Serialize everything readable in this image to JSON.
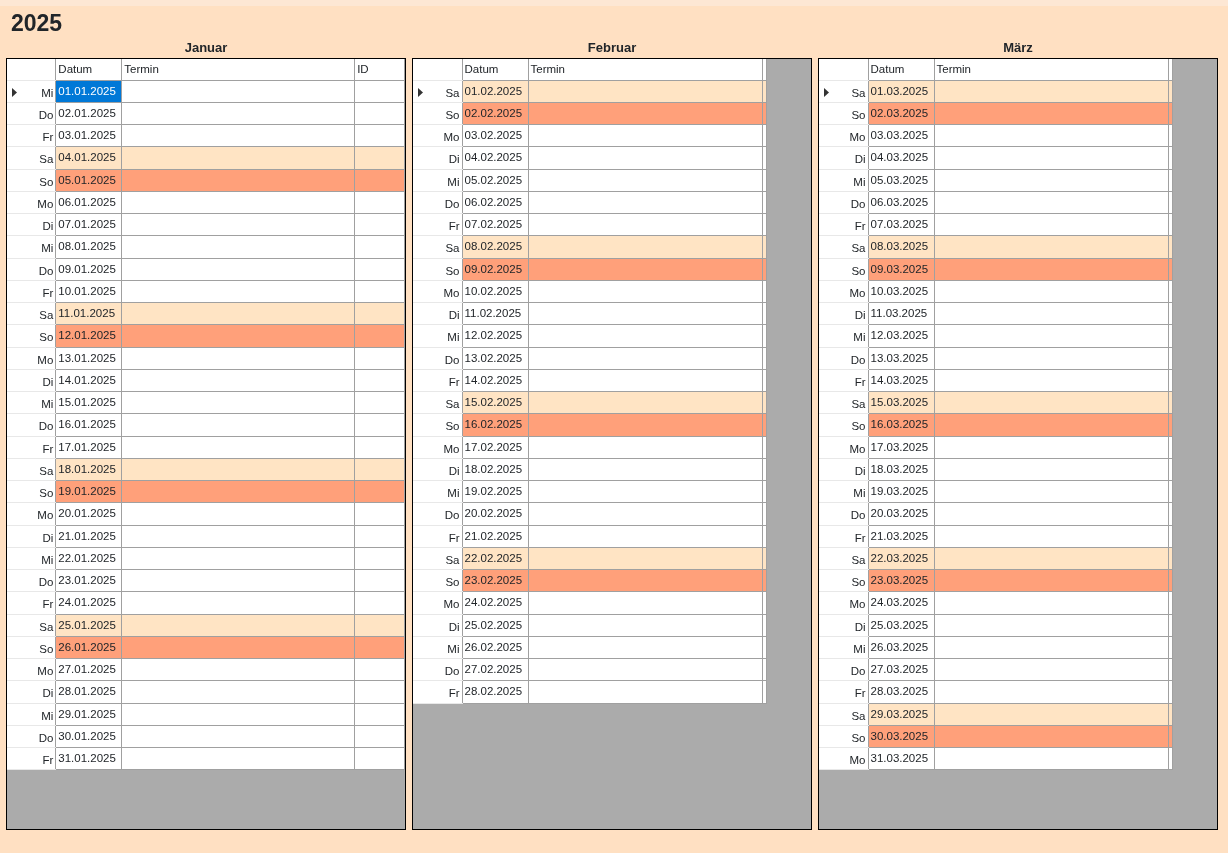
{
  "title": "2025",
  "months": [
    {
      "name": "Januar",
      "columns": [
        "Datum",
        "Termin",
        "ID"
      ],
      "rows": [
        {
          "day": "Mi",
          "date": "01.01.2025",
          "kind": "weekday",
          "current": true,
          "selected": true
        },
        {
          "day": "Do",
          "date": "02.01.2025",
          "kind": "weekday",
          "current": false,
          "selected": false
        },
        {
          "day": "Fr",
          "date": "03.01.2025",
          "kind": "weekday",
          "current": false,
          "selected": false
        },
        {
          "day": "Sa",
          "date": "04.01.2025",
          "kind": "saturday",
          "current": false,
          "selected": false
        },
        {
          "day": "So",
          "date": "05.01.2025",
          "kind": "sunday",
          "current": false,
          "selected": false
        },
        {
          "day": "Mo",
          "date": "06.01.2025",
          "kind": "weekday",
          "current": false,
          "selected": false
        },
        {
          "day": "Di",
          "date": "07.01.2025",
          "kind": "weekday",
          "current": false,
          "selected": false
        },
        {
          "day": "Mi",
          "date": "08.01.2025",
          "kind": "weekday",
          "current": false,
          "selected": false
        },
        {
          "day": "Do",
          "date": "09.01.2025",
          "kind": "weekday",
          "current": false,
          "selected": false
        },
        {
          "day": "Fr",
          "date": "10.01.2025",
          "kind": "weekday",
          "current": false,
          "selected": false
        },
        {
          "day": "Sa",
          "date": "11.01.2025",
          "kind": "saturday",
          "current": false,
          "selected": false
        },
        {
          "day": "So",
          "date": "12.01.2025",
          "kind": "sunday",
          "current": false,
          "selected": false
        },
        {
          "day": "Mo",
          "date": "13.01.2025",
          "kind": "weekday",
          "current": false,
          "selected": false
        },
        {
          "day": "Di",
          "date": "14.01.2025",
          "kind": "weekday",
          "current": false,
          "selected": false
        },
        {
          "day": "Mi",
          "date": "15.01.2025",
          "kind": "weekday",
          "current": false,
          "selected": false
        },
        {
          "day": "Do",
          "date": "16.01.2025",
          "kind": "weekday",
          "current": false,
          "selected": false
        },
        {
          "day": "Fr",
          "date": "17.01.2025",
          "kind": "weekday",
          "current": false,
          "selected": false
        },
        {
          "day": "Sa",
          "date": "18.01.2025",
          "kind": "saturday",
          "current": false,
          "selected": false
        },
        {
          "day": "So",
          "date": "19.01.2025",
          "kind": "sunday",
          "current": false,
          "selected": false
        },
        {
          "day": "Mo",
          "date": "20.01.2025",
          "kind": "weekday",
          "current": false,
          "selected": false
        },
        {
          "day": "Di",
          "date": "21.01.2025",
          "kind": "weekday",
          "current": false,
          "selected": false
        },
        {
          "day": "Mi",
          "date": "22.01.2025",
          "kind": "weekday",
          "current": false,
          "selected": false
        },
        {
          "day": "Do",
          "date": "23.01.2025",
          "kind": "weekday",
          "current": false,
          "selected": false
        },
        {
          "day": "Fr",
          "date": "24.01.2025",
          "kind": "weekday",
          "current": false,
          "selected": false
        },
        {
          "day": "Sa",
          "date": "25.01.2025",
          "kind": "saturday",
          "current": false,
          "selected": false
        },
        {
          "day": "So",
          "date": "26.01.2025",
          "kind": "sunday",
          "current": false,
          "selected": false
        },
        {
          "day": "Mo",
          "date": "27.01.2025",
          "kind": "weekday",
          "current": false,
          "selected": false
        },
        {
          "day": "Di",
          "date": "28.01.2025",
          "kind": "weekday",
          "current": false,
          "selected": false
        },
        {
          "day": "Mi",
          "date": "29.01.2025",
          "kind": "weekday",
          "current": false,
          "selected": false
        },
        {
          "day": "Do",
          "date": "30.01.2025",
          "kind": "weekday",
          "current": false,
          "selected": false
        },
        {
          "day": "Fr",
          "date": "31.01.2025",
          "kind": "weekday",
          "current": false,
          "selected": false
        }
      ]
    },
    {
      "name": "Februar",
      "columns": [
        "Datum",
        "Termin"
      ],
      "rows": [
        {
          "day": "Sa",
          "date": "01.02.2025",
          "kind": "saturday",
          "current": true,
          "selected": false
        },
        {
          "day": "So",
          "date": "02.02.2025",
          "kind": "sunday",
          "current": false,
          "selected": false
        },
        {
          "day": "Mo",
          "date": "03.02.2025",
          "kind": "weekday",
          "current": false,
          "selected": false
        },
        {
          "day": "Di",
          "date": "04.02.2025",
          "kind": "weekday",
          "current": false,
          "selected": false
        },
        {
          "day": "Mi",
          "date": "05.02.2025",
          "kind": "weekday",
          "current": false,
          "selected": false
        },
        {
          "day": "Do",
          "date": "06.02.2025",
          "kind": "weekday",
          "current": false,
          "selected": false
        },
        {
          "day": "Fr",
          "date": "07.02.2025",
          "kind": "weekday",
          "current": false,
          "selected": false
        },
        {
          "day": "Sa",
          "date": "08.02.2025",
          "kind": "saturday",
          "current": false,
          "selected": false
        },
        {
          "day": "So",
          "date": "09.02.2025",
          "kind": "sunday",
          "current": false,
          "selected": false
        },
        {
          "day": "Mo",
          "date": "10.02.2025",
          "kind": "weekday",
          "current": false,
          "selected": false
        },
        {
          "day": "Di",
          "date": "11.02.2025",
          "kind": "weekday",
          "current": false,
          "selected": false
        },
        {
          "day": "Mi",
          "date": "12.02.2025",
          "kind": "weekday",
          "current": false,
          "selected": false
        },
        {
          "day": "Do",
          "date": "13.02.2025",
          "kind": "weekday",
          "current": false,
          "selected": false
        },
        {
          "day": "Fr",
          "date": "14.02.2025",
          "kind": "weekday",
          "current": false,
          "selected": false
        },
        {
          "day": "Sa",
          "date": "15.02.2025",
          "kind": "saturday",
          "current": false,
          "selected": false
        },
        {
          "day": "So",
          "date": "16.02.2025",
          "kind": "sunday",
          "current": false,
          "selected": false
        },
        {
          "day": "Mo",
          "date": "17.02.2025",
          "kind": "weekday",
          "current": false,
          "selected": false
        },
        {
          "day": "Di",
          "date": "18.02.2025",
          "kind": "weekday",
          "current": false,
          "selected": false
        },
        {
          "day": "Mi",
          "date": "19.02.2025",
          "kind": "weekday",
          "current": false,
          "selected": false
        },
        {
          "day": "Do",
          "date": "20.02.2025",
          "kind": "weekday",
          "current": false,
          "selected": false
        },
        {
          "day": "Fr",
          "date": "21.02.2025",
          "kind": "weekday",
          "current": false,
          "selected": false
        },
        {
          "day": "Sa",
          "date": "22.02.2025",
          "kind": "saturday",
          "current": false,
          "selected": false
        },
        {
          "day": "So",
          "date": "23.02.2025",
          "kind": "sunday",
          "current": false,
          "selected": false
        },
        {
          "day": "Mo",
          "date": "24.02.2025",
          "kind": "weekday",
          "current": false,
          "selected": false
        },
        {
          "day": "Di",
          "date": "25.02.2025",
          "kind": "weekday",
          "current": false,
          "selected": false
        },
        {
          "day": "Mi",
          "date": "26.02.2025",
          "kind": "weekday",
          "current": false,
          "selected": false
        },
        {
          "day": "Do",
          "date": "27.02.2025",
          "kind": "weekday",
          "current": false,
          "selected": false
        },
        {
          "day": "Fr",
          "date": "28.02.2025",
          "kind": "weekday",
          "current": false,
          "selected": false
        }
      ]
    },
    {
      "name": "März",
      "columns": [
        "Datum",
        "Termin"
      ],
      "rows": [
        {
          "day": "Sa",
          "date": "01.03.2025",
          "kind": "saturday",
          "current": true,
          "selected": false
        },
        {
          "day": "So",
          "date": "02.03.2025",
          "kind": "sunday",
          "current": false,
          "selected": false
        },
        {
          "day": "Mo",
          "date": "03.03.2025",
          "kind": "weekday",
          "current": false,
          "selected": false
        },
        {
          "day": "Di",
          "date": "04.03.2025",
          "kind": "weekday",
          "current": false,
          "selected": false
        },
        {
          "day": "Mi",
          "date": "05.03.2025",
          "kind": "weekday",
          "current": false,
          "selected": false
        },
        {
          "day": "Do",
          "date": "06.03.2025",
          "kind": "weekday",
          "current": false,
          "selected": false
        },
        {
          "day": "Fr",
          "date": "07.03.2025",
          "kind": "weekday",
          "current": false,
          "selected": false
        },
        {
          "day": "Sa",
          "date": "08.03.2025",
          "kind": "saturday",
          "current": false,
          "selected": false
        },
        {
          "day": "So",
          "date": "09.03.2025",
          "kind": "sunday",
          "current": false,
          "selected": false
        },
        {
          "day": "Mo",
          "date": "10.03.2025",
          "kind": "weekday",
          "current": false,
          "selected": false
        },
        {
          "day": "Di",
          "date": "11.03.2025",
          "kind": "weekday",
          "current": false,
          "selected": false
        },
        {
          "day": "Mi",
          "date": "12.03.2025",
          "kind": "weekday",
          "current": false,
          "selected": false
        },
        {
          "day": "Do",
          "date": "13.03.2025",
          "kind": "weekday",
          "current": false,
          "selected": false
        },
        {
          "day": "Fr",
          "date": "14.03.2025",
          "kind": "weekday",
          "current": false,
          "selected": false
        },
        {
          "day": "Sa",
          "date": "15.03.2025",
          "kind": "saturday",
          "current": false,
          "selected": false
        },
        {
          "day": "So",
          "date": "16.03.2025",
          "kind": "sunday",
          "current": false,
          "selected": false
        },
        {
          "day": "Mo",
          "date": "17.03.2025",
          "kind": "weekday",
          "current": false,
          "selected": false
        },
        {
          "day": "Di",
          "date": "18.03.2025",
          "kind": "weekday",
          "current": false,
          "selected": false
        },
        {
          "day": "Mi",
          "date": "19.03.2025",
          "kind": "weekday",
          "current": false,
          "selected": false
        },
        {
          "day": "Do",
          "date": "20.03.2025",
          "kind": "weekday",
          "current": false,
          "selected": false
        },
        {
          "day": "Fr",
          "date": "21.03.2025",
          "kind": "weekday",
          "current": false,
          "selected": false
        },
        {
          "day": "Sa",
          "date": "22.03.2025",
          "kind": "saturday",
          "current": false,
          "selected": false
        },
        {
          "day": "So",
          "date": "23.03.2025",
          "kind": "sunday",
          "current": false,
          "selected": false
        },
        {
          "day": "Mo",
          "date": "24.03.2025",
          "kind": "weekday",
          "current": false,
          "selected": false
        },
        {
          "day": "Di",
          "date": "25.03.2025",
          "kind": "weekday",
          "current": false,
          "selected": false
        },
        {
          "day": "Mi",
          "date": "26.03.2025",
          "kind": "weekday",
          "current": false,
          "selected": false
        },
        {
          "day": "Do",
          "date": "27.03.2025",
          "kind": "weekday",
          "current": false,
          "selected": false
        },
        {
          "day": "Fr",
          "date": "28.03.2025",
          "kind": "weekday",
          "current": false,
          "selected": false
        },
        {
          "day": "Sa",
          "date": "29.03.2025",
          "kind": "saturday",
          "current": false,
          "selected": false
        },
        {
          "day": "So",
          "date": "30.03.2025",
          "kind": "sunday",
          "current": false,
          "selected": false
        },
        {
          "day": "Mo",
          "date": "31.03.2025",
          "kind": "weekday",
          "current": false,
          "selected": false
        }
      ]
    }
  ]
}
